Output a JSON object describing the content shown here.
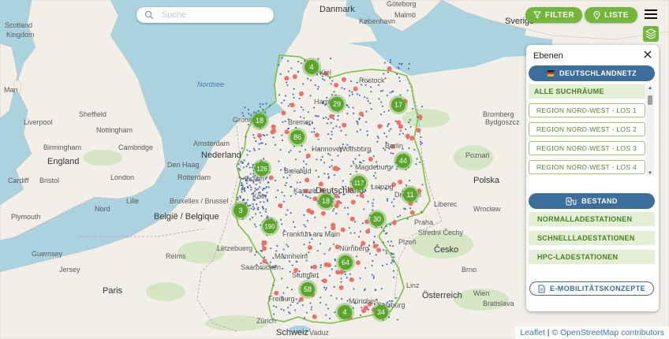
{
  "search": {
    "placeholder": "Suche"
  },
  "top_buttons": {
    "filter_label": "FILTER",
    "list_label": "LISTE"
  },
  "panel": {
    "title": "Ebenen",
    "network_label": "DEUTSCHLANDNETZ",
    "all_search_areas": "ALLE SUCHRÄUME",
    "regions": [
      "REGION NORD-WEST - LOS 1",
      "REGION NORD-WEST - LOS 2",
      "REGION NORD-WEST - LOS 3",
      "REGION NORD-WEST - LOS 4"
    ],
    "stock_label": "BESTAND",
    "stock_items": [
      "NORMALLADESTATIONEN",
      "SCHNELLLADESTATIONEN",
      "HPC-LADESTATIONEN"
    ],
    "emobility_label": "E-MOBILITÄTSKONZEPTE"
  },
  "clusters": [
    {
      "count": "4"
    },
    {
      "count": "29"
    },
    {
      "count": "17"
    },
    {
      "count": "18"
    },
    {
      "count": "86"
    },
    {
      "count": "126"
    },
    {
      "count": "44"
    },
    {
      "count": "117"
    },
    {
      "count": "11"
    },
    {
      "count": "18"
    },
    {
      "count": "30"
    },
    {
      "count": "3"
    },
    {
      "count": "190"
    },
    {
      "count": "64"
    },
    {
      "count": "58"
    },
    {
      "count": "4"
    },
    {
      "count": "34"
    }
  ],
  "map_labels": {
    "gb_scotland": "Scotland",
    "kingdom": "Kingdom",
    "man": "Man",
    "liverpool": "Liverpool",
    "sheffield": "Sheffield",
    "nottingham": "Nottingham",
    "birmingham": "Birmingham",
    "cambridge": "Cambridge",
    "england": "England",
    "london": "London",
    "cardiff": "Cardiff",
    "bristol": "Bristol",
    "guernsey": "Guernsey",
    "jersey": "Jersey",
    "plymouth": "Plymouth",
    "den_haag": "Den Haag",
    "nederland": "Nederland",
    "groningen": "Groningen",
    "amsterdam": "Amsterdam",
    "rotterdam": "Rotterdam",
    "belgie": "België / Belgique",
    "bruxelles": "Bruxelles / Brussel",
    "luxembourg": "Lëtzebuerg",
    "lille": "Lille",
    "nord": "Nord",
    "paris": "Paris",
    "reims": "Reims",
    "koebenhavn": "København",
    "malmoe": "Malmö",
    "goeteborg": "Göteborg",
    "danmark": "Danmark",
    "sverige": "Sverige",
    "bromberg": "Bromberg",
    "bydgoszcz": "Bydgoszcz",
    "poznan": "Poznań",
    "polska": "Polska",
    "wroclaw": "Wrocław",
    "praha": "Praha",
    "cesko": "Česko",
    "osterreich": "Österreich",
    "wien": "Wien",
    "bratislava": "Bratislava",
    "brno": "Brno",
    "swiss": "Schweiz",
    "zurich": "Zürich",
    "vaduz": "Vaduz",
    "salzburg": "Salzburg",
    "munchen": "München",
    "hamburg": "Hamburg",
    "bremen": "Bremen",
    "hannover": "Hannover",
    "berlin": "Berlin",
    "leipzig": "Leipzig",
    "dresden": "Dresden",
    "deutschland": "Deutschland",
    "kassel": "Kassel",
    "frankfurt": "Frankfurt am Main",
    "mannheim": "Mannheim",
    "stuttgart": "Stuttgart",
    "nurnberg": "Nürnberg",
    "koln": "Köln",
    "wolfsburg": "Wolfsburg",
    "rostock": "Rostock",
    "kiel": "Kiel",
    "essen": "Essen",
    "bielefeld": "Bielefeld",
    "magdeburg": "Magdeburg",
    "saarbrucken": "Saarbrücken",
    "freiburg": "Freiburg",
    "liberec": "Liberec",
    "plzen": "Plzeň",
    "linz": "Linz",
    "praha_region": "Střední Čechy",
    "nordsee": "Nordsee"
  },
  "attribution": {
    "leaflet": "Leaflet",
    "osm": "© OpenStreetMap contributors"
  },
  "colors": {
    "accent_green": "#72b73a",
    "accent_blue": "#3b6e9a",
    "cluster": "#5aa52c",
    "marker_blue": "#3a67b0",
    "marker_red": "#f07066"
  }
}
